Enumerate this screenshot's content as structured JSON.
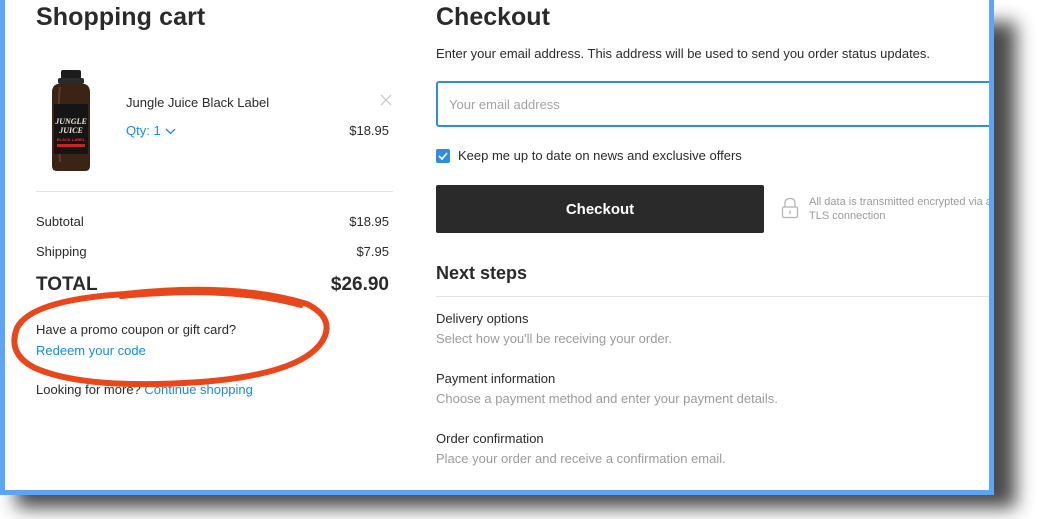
{
  "cart": {
    "title": "Shopping cart",
    "item": {
      "name": "Jungle Juice Black Label",
      "qty_label": "Qty: 1",
      "price": "$18.95",
      "image_label_top": "JUNGLE",
      "image_label_mid": "JUICE",
      "image_label_bottom": "BLACK LABEL"
    },
    "summary": {
      "subtotal_label": "Subtotal",
      "subtotal_value": "$18.95",
      "shipping_label": "Shipping",
      "shipping_value": "$7.95",
      "total_label": "TOTAL",
      "total_value": "$26.90"
    },
    "promo": {
      "question": "Have a promo coupon or gift card?",
      "link": "Redeem your code"
    },
    "more": {
      "text": "Looking for more?",
      "link": "Continue shopping"
    }
  },
  "checkout": {
    "title": "Checkout",
    "description": "Enter your email address. This address will be used to send you order status updates.",
    "email_placeholder": "Your email address",
    "email_value": "",
    "newsletter_label": "Keep me up to date on news and exclusive offers",
    "newsletter_checked": true,
    "button_label": "Checkout",
    "secure_line1": "All data is transmitted encrypted via a secure",
    "secure_line2": "TLS connection"
  },
  "next_steps": {
    "title": "Next steps",
    "items": [
      {
        "title": "Delivery options",
        "desc": "Select how you'll be receiving your order."
      },
      {
        "title": "Payment information",
        "desc": "Choose a payment method and enter your payment details."
      },
      {
        "title": "Order confirmation",
        "desc": "Place your order and receive a confirmation email."
      }
    ]
  },
  "colors": {
    "frame_border": "#5fa3f2",
    "link": "#1a8bd6",
    "button_bg": "#2a2a2a",
    "annotation": "#e8471b",
    "focus": "#2e8de0"
  },
  "icons": [
    "close-icon",
    "chevron-down-icon",
    "checkmark-icon",
    "lock-icon"
  ]
}
